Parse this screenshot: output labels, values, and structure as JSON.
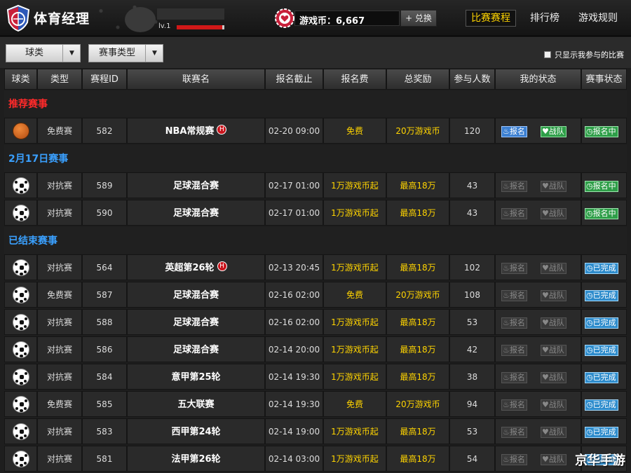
{
  "header": {
    "brand": "体育经理",
    "level": "lv.1",
    "xp_fraction": 0.95,
    "coins_label": "游戏币：6,667",
    "exchange_label": "+ 兑换",
    "nav": [
      {
        "label": "比赛赛程",
        "active": true
      },
      {
        "label": "排行榜",
        "active": false
      },
      {
        "label": "游戏规则",
        "active": false
      }
    ]
  },
  "filters": {
    "sport_select": "球类",
    "type_select": "赛事类型",
    "only_mine_label": "只显示我参与的比赛",
    "only_mine_checked": false
  },
  "columns": [
    "球类",
    "类型",
    "赛程ID",
    "联赛名",
    "报名截止",
    "报名费",
    "总奖励",
    "参与人数",
    "我的状态",
    "赛事状态"
  ],
  "sections": [
    {
      "title": "推荐赛事",
      "color": "red",
      "rows": [
        {
          "sport": "basketball",
          "type": "免费赛",
          "id": "582",
          "league": "NBA常规赛",
          "hot": true,
          "deadline": "02-20 09:00",
          "fee": "免费",
          "reward": "20万游戏币",
          "players": "120",
          "signup": "报名",
          "team": "战队",
          "my_active": true,
          "status": "报名中",
          "status_kind": "signup"
        }
      ]
    },
    {
      "title": "2月17日赛事",
      "color": "blue",
      "rows": [
        {
          "sport": "soccer",
          "type": "对抗赛",
          "id": "589",
          "league": "足球混合赛",
          "hot": false,
          "deadline": "02-17 01:00",
          "fee": "1万游戏币起",
          "reward": "最高18万",
          "players": "43",
          "signup": "报名",
          "team": "战队",
          "my_active": false,
          "status": "报名中",
          "status_kind": "signup"
        },
        {
          "sport": "soccer",
          "type": "对抗赛",
          "id": "590",
          "league": "足球混合赛",
          "hot": false,
          "deadline": "02-17 01:00",
          "fee": "1万游戏币起",
          "reward": "最高18万",
          "players": "43",
          "signup": "报名",
          "team": "战队",
          "my_active": false,
          "status": "报名中",
          "status_kind": "signup"
        }
      ]
    },
    {
      "title": "已结束赛事",
      "color": "blue",
      "rows": [
        {
          "sport": "soccer",
          "type": "对抗赛",
          "id": "564",
          "league": "英超第26轮",
          "hot": true,
          "deadline": "02-13 20:45",
          "fee": "1万游戏币起",
          "reward": "最高18万",
          "players": "102",
          "signup": "报名",
          "team": "战队",
          "my_active": false,
          "status": "已完成",
          "status_kind": "done"
        },
        {
          "sport": "soccer",
          "type": "免费赛",
          "id": "587",
          "league": "足球混合赛",
          "hot": false,
          "deadline": "02-16 02:00",
          "fee": "免费",
          "reward": "20万游戏币",
          "players": "108",
          "signup": "报名",
          "team": "战队",
          "my_active": false,
          "status": "已完成",
          "status_kind": "done"
        },
        {
          "sport": "soccer",
          "type": "对抗赛",
          "id": "588",
          "league": "足球混合赛",
          "hot": false,
          "deadline": "02-16 02:00",
          "fee": "1万游戏币起",
          "reward": "最高18万",
          "players": "53",
          "signup": "报名",
          "team": "战队",
          "my_active": false,
          "status": "已完成",
          "status_kind": "done"
        },
        {
          "sport": "soccer",
          "type": "对抗赛",
          "id": "586",
          "league": "足球混合赛",
          "hot": false,
          "deadline": "02-14 20:00",
          "fee": "1万游戏币起",
          "reward": "最高18万",
          "players": "42",
          "signup": "报名",
          "team": "战队",
          "my_active": false,
          "status": "已完成",
          "status_kind": "done"
        },
        {
          "sport": "soccer",
          "type": "对抗赛",
          "id": "584",
          "league": "意甲第25轮",
          "hot": false,
          "deadline": "02-14 19:30",
          "fee": "1万游戏币起",
          "reward": "最高18万",
          "players": "38",
          "signup": "报名",
          "team": "战队",
          "my_active": false,
          "status": "已完成",
          "status_kind": "done"
        },
        {
          "sport": "soccer",
          "type": "免费赛",
          "id": "585",
          "league": "五大联赛",
          "hot": false,
          "deadline": "02-14 19:30",
          "fee": "免费",
          "reward": "20万游戏币",
          "players": "94",
          "signup": "报名",
          "team": "战队",
          "my_active": false,
          "status": "已完成",
          "status_kind": "done"
        },
        {
          "sport": "soccer",
          "type": "对抗赛",
          "id": "583",
          "league": "西甲第24轮",
          "hot": false,
          "deadline": "02-14 19:00",
          "fee": "1万游戏币起",
          "reward": "最高18万",
          "players": "53",
          "signup": "报名",
          "team": "战队",
          "my_active": false,
          "status": "已完成",
          "status_kind": "done"
        },
        {
          "sport": "soccer",
          "type": "对抗赛",
          "id": "581",
          "league": "法甲第26轮",
          "hot": false,
          "deadline": "02-14 03:00",
          "fee": "1万游戏币起",
          "reward": "最高18万",
          "players": "54",
          "signup": "报名",
          "team": "战队",
          "my_active": false,
          "status": "已完成",
          "status_kind": "done"
        }
      ]
    }
  ],
  "watermark": "京华手游"
}
